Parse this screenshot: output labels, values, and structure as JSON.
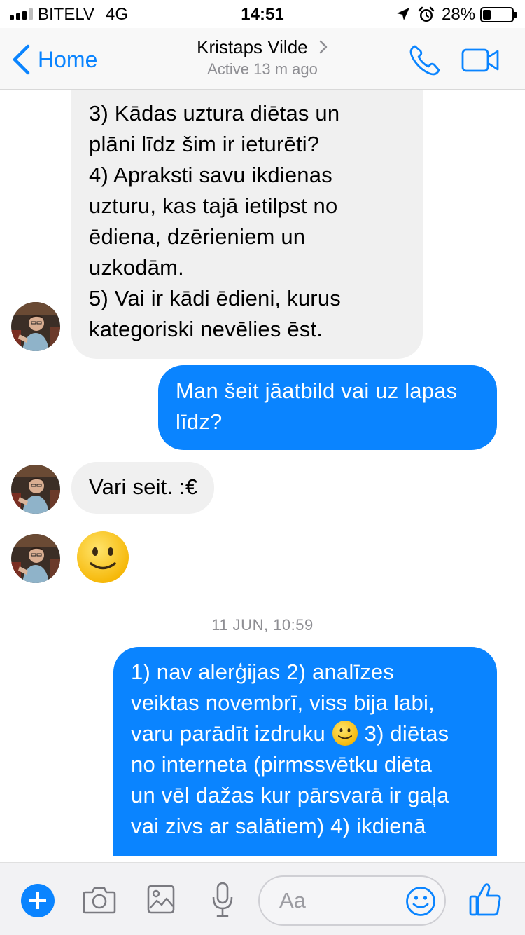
{
  "status_bar": {
    "carrier": "BITELV",
    "network": "4G",
    "time": "14:51",
    "battery_percent_label": "28%",
    "battery_level": 0.28,
    "signal_bars": 3,
    "icons": [
      "signal-icon",
      "location-arrow-icon",
      "alarm-clock-icon",
      "battery-icon"
    ]
  },
  "nav": {
    "back_label": "Home",
    "contact_name": "Kristaps Vilde",
    "contact_status": "Active 13 m ago",
    "icons": [
      "chevron-left-icon",
      "chevron-right-icon",
      "phone-icon",
      "video-camera-icon"
    ]
  },
  "conversation": {
    "messages": [
      {
        "direction": "incoming",
        "lines": [
          "3) Kādas uztura diētas un",
          "plāni līdz šim ir ieturēti?",
          "4) Apraksti savu ikdienas",
          "uzturu, kas tajā ietilpst no",
          "ēdiena, dzērieniem un",
          "uzkodām.",
          "5) Vai ir kādi ēdieni, kurus",
          "kategoriski nevēlies ēst."
        ]
      },
      {
        "direction": "outgoing",
        "lines": [
          "Man šeit jāatbild vai uz lapas",
          "līdz?"
        ]
      },
      {
        "direction": "incoming",
        "text": "Vari seit. :€"
      },
      {
        "direction": "incoming",
        "emoji": "slightly-smiling-face"
      },
      {
        "direction": "outgoing",
        "lines": [
          "1) nav alerģijas 2) analīzes",
          "veiktas novembrī, viss bija labi,",
          "varu parādīt izdruku",
          "3) diētas",
          "no interneta (pirmssvētku diēta",
          "un vēl dažas kur pārsvarā ir gaļa",
          "vai zivs ar salātiem) 4) ikdienā"
        ]
      }
    ],
    "timestamp": "11 JUN, 10:59"
  },
  "composer": {
    "placeholder": "Aa",
    "icons": [
      "plus-icon",
      "camera-icon",
      "image-icon",
      "microphone-icon",
      "smiley-icon",
      "thumbs-up-icon"
    ]
  },
  "colors": {
    "accent": "#0a84ff",
    "incoming_bubble": "#f0f0f0",
    "outgoing_bubble": "#0a84ff",
    "secondary_text": "#8e8e93"
  }
}
